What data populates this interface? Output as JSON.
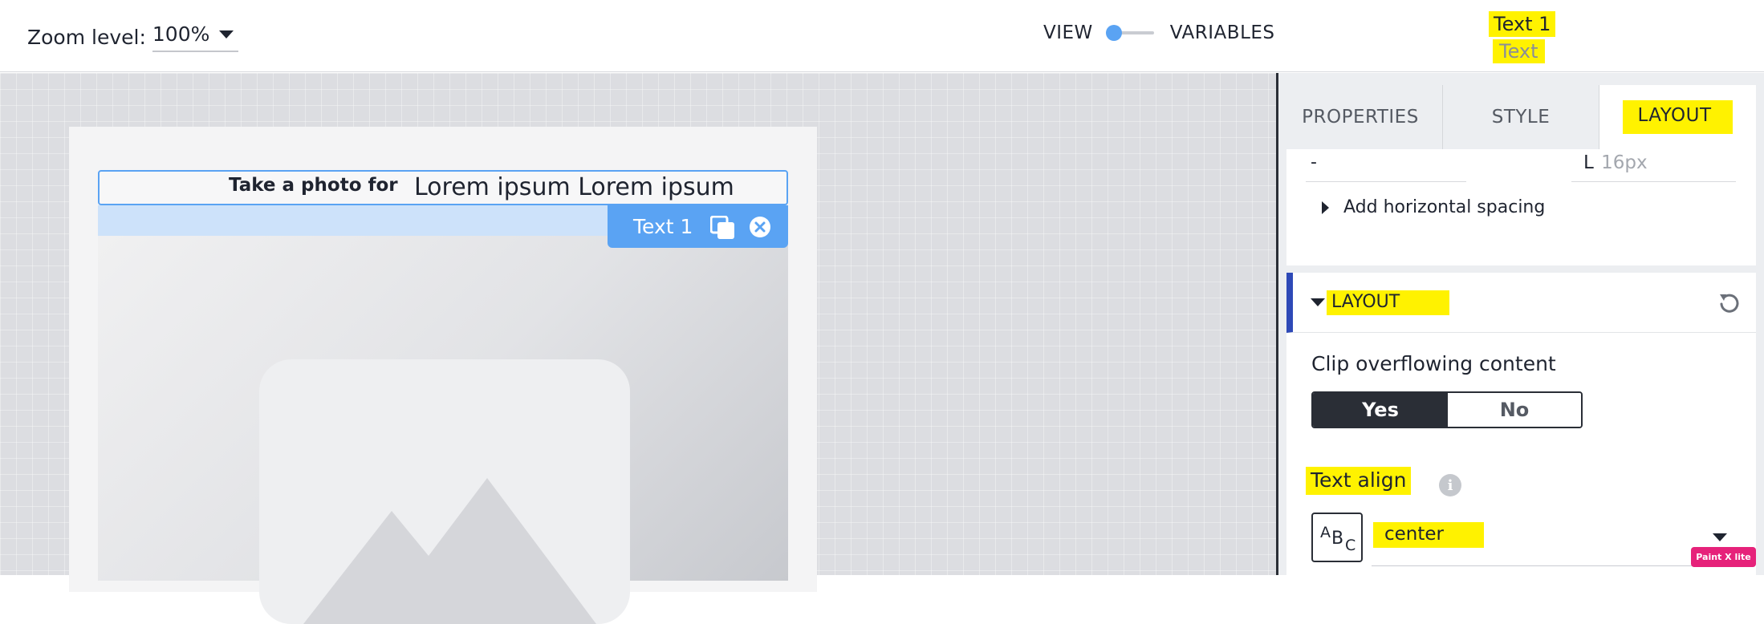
{
  "topbar": {
    "zoom_label": "Zoom level:",
    "zoom_value": "100%",
    "view_label": "VIEW",
    "variables_label": "VARIABLES",
    "selected_name": "Text 1",
    "selected_type": "Text"
  },
  "canvas": {
    "text_bold": "Take a photo for",
    "text_body": "Lorem ipsum Lorem ipsum",
    "component_label": "Text 1"
  },
  "panel": {
    "tabs": [
      {
        "label": "PROPERTIES"
      },
      {
        "label": "STYLE"
      },
      {
        "label": "LAYOUT",
        "active": true
      }
    ],
    "spacing": {
      "left_value": "-",
      "right_prefix": "L",
      "right_placeholder": "16px",
      "add_horizontal": "Add horizontal spacing"
    },
    "layout_section": {
      "title": "LAYOUT",
      "clip_label": "Clip overflowing content",
      "clip_yes": "Yes",
      "clip_no": "No",
      "clip_selected": "Yes",
      "align_label": "Text align",
      "align_icon_text": {
        "a": "A",
        "b": "B",
        "c": "C"
      },
      "align_value": "center"
    }
  },
  "watermark": "Paint X lite",
  "colors": {
    "accent_blue": "#5aa3f3",
    "section_bar": "#2e49b7",
    "highlight": "#fff200",
    "dark": "#2a2e36"
  },
  "icons": [
    "chevron-down-icon",
    "duplicate-icon",
    "close-circle-icon",
    "caret-right-icon",
    "reset-icon",
    "info-icon",
    "text-align-icon",
    "image-placeholder-icon"
  ]
}
